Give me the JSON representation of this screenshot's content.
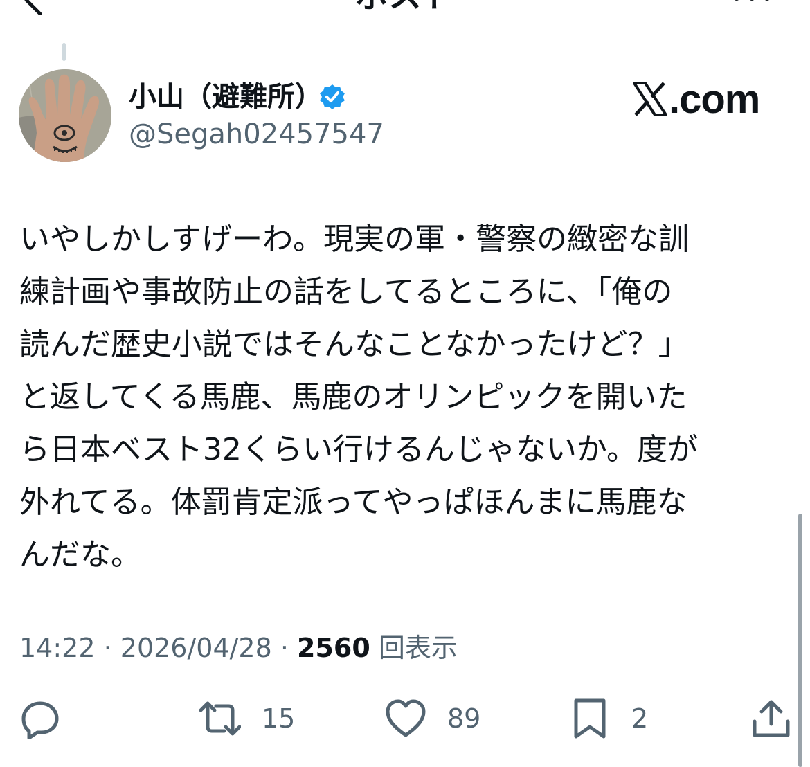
{
  "header": {
    "title": "ポスト",
    "back_icon": "chevron-left-icon",
    "more_icon": "more-horizontal-icon"
  },
  "author": {
    "name": "小山（避難所）",
    "handle": "@Segah02457547",
    "verified": true,
    "verified_color": "#1d9bf0"
  },
  "watermark": {
    "text": ".com"
  },
  "tweet": {
    "lines": [
      "いやしかしすげーわ。現実の軍・警察の緻密な訓",
      "練計画や事故防止の話をしてるところに、「俺の",
      "読んだ歴史小説ではそんなことなかったけど？」",
      "と返してくる馬鹿、馬鹿のオリンピックを開いた",
      "ら日本ベスト32くらい行けるんじゃないか。度が",
      "外れてる。体罰肯定派ってやっぱほんまに馬鹿な",
      "んだな。"
    ]
  },
  "meta": {
    "time": "14:22",
    "separator": " · ",
    "date": "2026/04/28",
    "views_count": "2560",
    "views_label": "回表示"
  },
  "actions": {
    "reply": {
      "icon": "reply-icon",
      "count": ""
    },
    "repost": {
      "icon": "repost-icon",
      "count": "15"
    },
    "like": {
      "icon": "heart-icon",
      "count": "89"
    },
    "bookmark": {
      "icon": "bookmark-icon",
      "count": "2"
    },
    "share": {
      "icon": "share-icon"
    }
  },
  "colors": {
    "text_primary": "#0f1419",
    "text_secondary": "#536471",
    "accent": "#1d9bf0"
  }
}
